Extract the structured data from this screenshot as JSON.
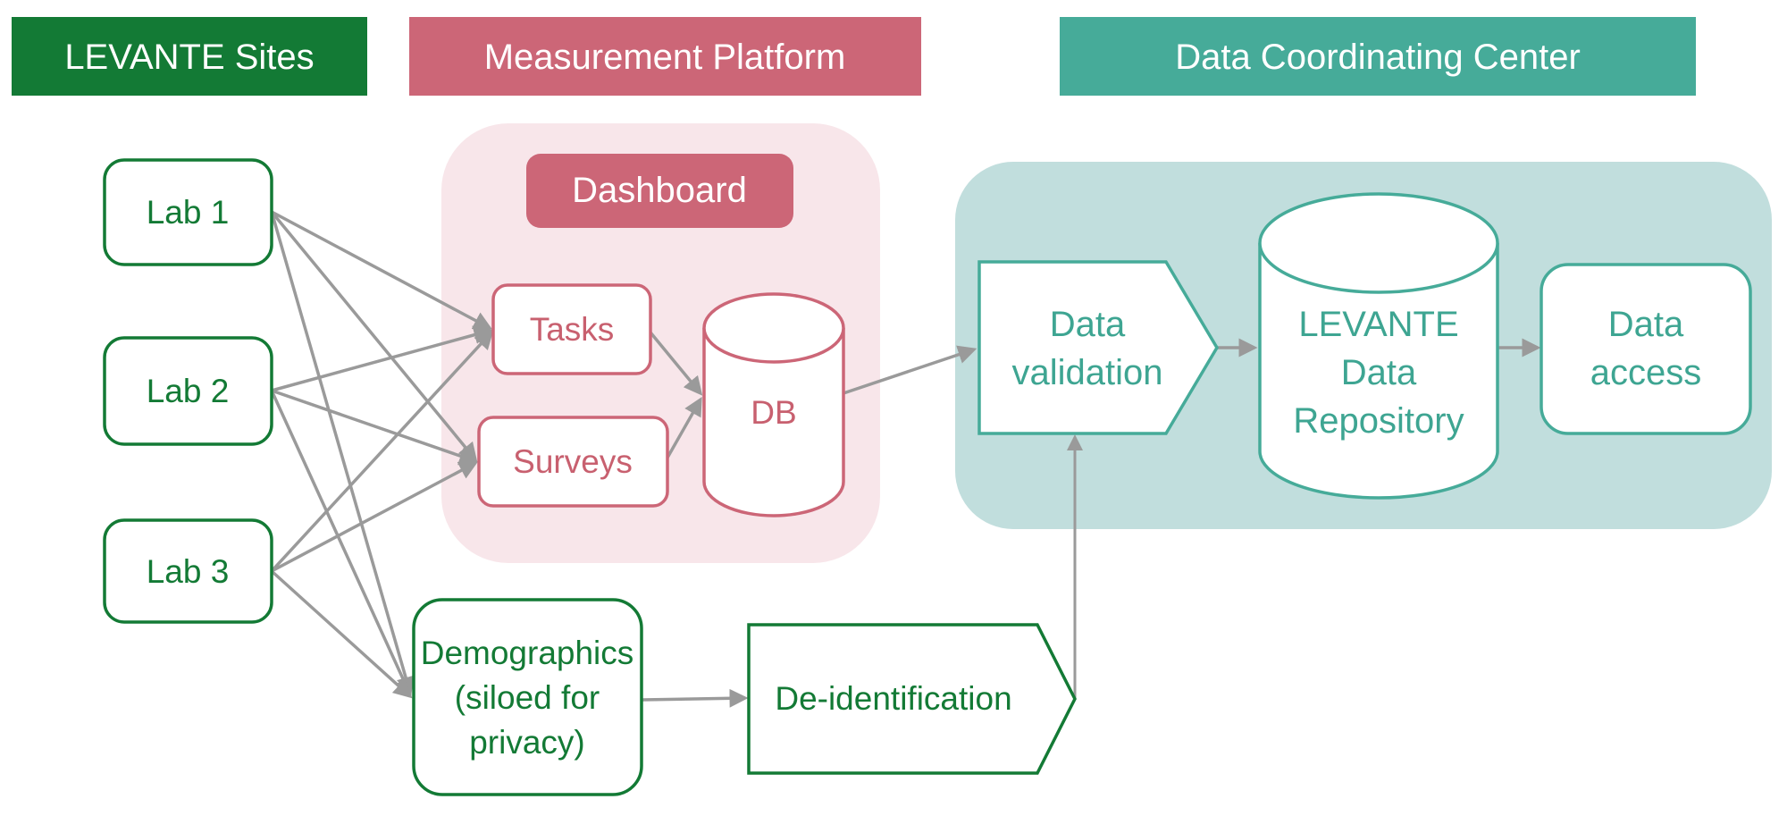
{
  "headers": {
    "sites": "LEVANTE Sites",
    "platform": "Measurement Platform",
    "dcc": "Data Coordinating Center"
  },
  "sites": {
    "lab1": "Lab 1",
    "lab2": "Lab 2",
    "lab3": "Lab 3",
    "demographics": [
      "Demographics",
      "(siloed for",
      "privacy)"
    ],
    "deidentification": "De-identification"
  },
  "platform": {
    "dashboard": "Dashboard",
    "tasks": "Tasks",
    "surveys": "Surveys",
    "db": "DB"
  },
  "dcc": {
    "validation": [
      "Data",
      "validation"
    ],
    "repository": [
      "LEVANTE",
      "Data",
      "Repository"
    ],
    "access": [
      "Data",
      "access"
    ]
  },
  "colors": {
    "sites_green": "#137a35",
    "platform_pink": "#cc6677",
    "platform_bg": "#f8e6ea",
    "dcc_teal": "#46ab99",
    "dcc_bg": "#c1dedd",
    "arrow_gray": "#9a9a9a"
  }
}
